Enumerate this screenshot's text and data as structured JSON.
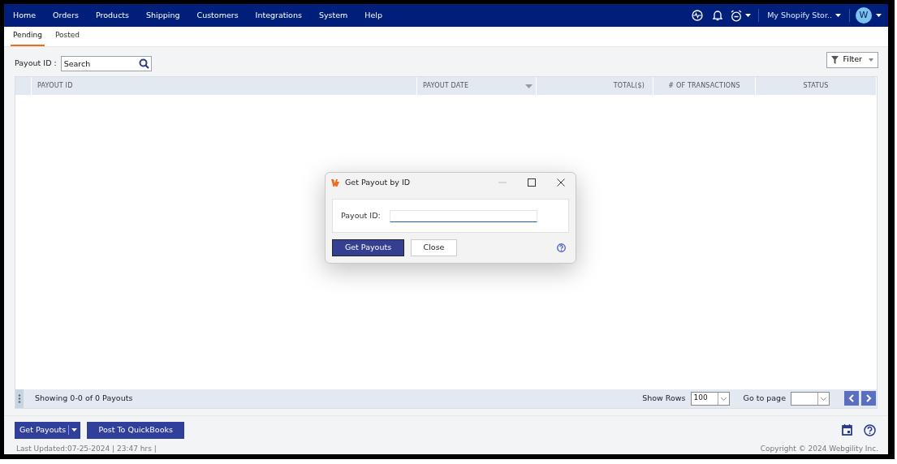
{
  "nav": {
    "items": [
      "Home",
      "Orders",
      "Products",
      "Shipping",
      "Customers",
      "Integrations",
      "System",
      "Help"
    ],
    "store": "My Shopify Stor..",
    "avatar": "W"
  },
  "tabs": [
    {
      "label": "Pending",
      "selected": true
    },
    {
      "label": "Posted",
      "selected": false
    }
  ],
  "search": {
    "label": "Payout ID :",
    "placeholder": "Search"
  },
  "filter_button": "Filter",
  "table": {
    "columns": [
      {
        "label": "PAYOUT ID",
        "sortable": false
      },
      {
        "label": "PAYOUT DATE",
        "sortable": true
      },
      {
        "label": "TOTAL($)",
        "sortable": false
      },
      {
        "label": "# OF TRANSACTIONS",
        "sortable": false
      },
      {
        "label": "STATUS",
        "sortable": false
      }
    ]
  },
  "table_footer": {
    "summary": "Showing 0-0 of 0 Payouts",
    "show_rows_label": "Show Rows",
    "show_rows_value": "100",
    "goto_label": "Go to page"
  },
  "actions": {
    "get_payouts": "Get Payouts",
    "post": "Post To QuickBooks"
  },
  "last_updated": "Last Updated:07-25-2024 | 23:47 hrs |",
  "copyright": "Copyright © 2024 Webgility Inc.",
  "dialog": {
    "title": "Get Payout by ID",
    "field_label": "Payout ID:",
    "buttons": [
      "Get Payouts",
      "Close"
    ]
  }
}
